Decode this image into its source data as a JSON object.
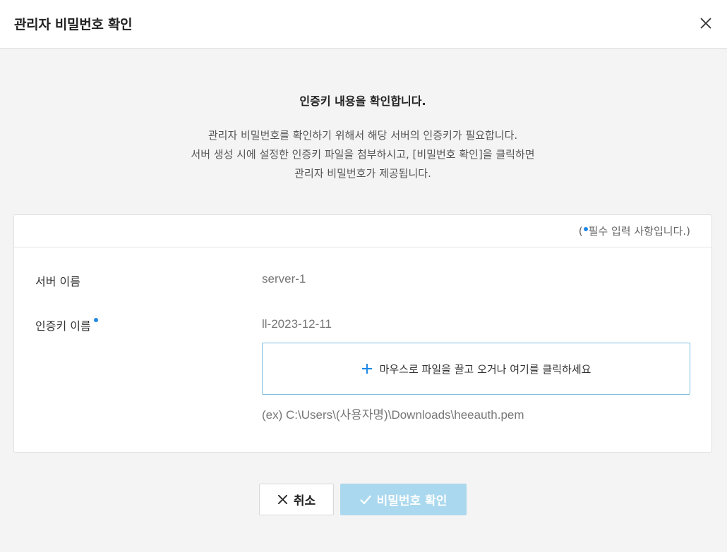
{
  "header": {
    "title": "관리자 비밀번호 확인",
    "close_icon": "close-icon"
  },
  "intro": {
    "title": "인증키 내용을 확인합니다.",
    "lines": [
      "관리자 비밀번호를 확인하기 위해서 해당 서버의 인증키가 필요합니다.",
      "서버 생성 시에 설정한 인증키 파일을 첨부하시고, [비밀번호 확인]을 클릭하면",
      "관리자 비밀번호가 제공됩니다."
    ]
  },
  "form": {
    "required_note": {
      "open": "(",
      "text": "필수 입력 사항입니다.)"
    },
    "server_name": {
      "label": "서버 이름",
      "value": "server-1"
    },
    "auth_key": {
      "label": "인증키 이름",
      "value": "ll-2023-12-11",
      "required": true
    },
    "dropzone": {
      "icon": "plus-icon",
      "text": "마우스로 파일을 끌고 오거나 여기를 클릭하세요"
    },
    "hint": "(ex) C:\\Users\\(사용자명)\\Downloads\\heeauth.pem"
  },
  "buttons": {
    "cancel": {
      "label": "취소",
      "icon": "close-icon"
    },
    "confirm": {
      "label": "비밀번호 확인",
      "icon": "check-icon",
      "disabled": true
    }
  },
  "colors": {
    "accent": "#1e88e5",
    "confirm_disabled": "#aad8ee",
    "dropzone_border": "#7fbfe0"
  }
}
